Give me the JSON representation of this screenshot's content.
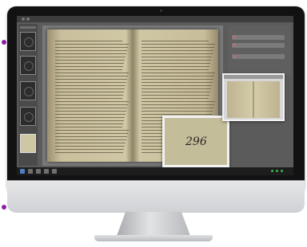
{
  "colors": {
    "marker": "#8a1fa6",
    "bezel": "#121212",
    "app_background": "#5b5b5b",
    "page": "#cfc6a4",
    "accent_row": "#c86a6a",
    "tray_status": "#3db34a"
  },
  "viewer": {
    "zoom_inset": {
      "page_number": "296"
    }
  },
  "icons": {
    "camera": "camera-dot",
    "tray_indicators": "status-dot"
  }
}
